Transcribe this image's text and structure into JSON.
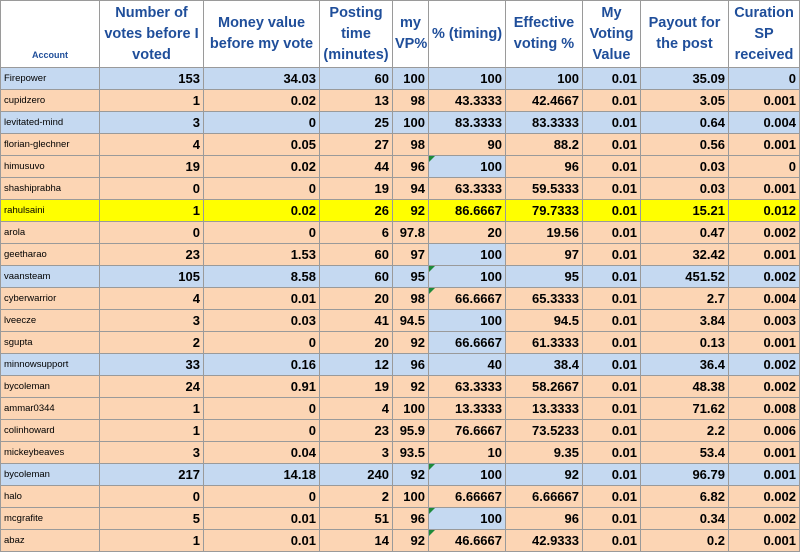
{
  "headers": [
    "Account",
    "Number of votes before I voted",
    "Money value before my vote",
    "Posting time (minutes)",
    "my VP%",
    "% (timing)",
    "Effective voting %",
    "My Voting Value",
    "Payout for the post",
    "Curation SP received"
  ],
  "rows": [
    {
      "account": "Firepower",
      "votes": "153",
      "money": "34.03",
      "time": "60",
      "vp": "100",
      "timing": "100",
      "effective": "100",
      "value": "0.01",
      "payout": "35.09",
      "curation": "0",
      "bg": "blue"
    },
    {
      "account": "cupidzero",
      "votes": "1",
      "money": "0.02",
      "time": "13",
      "vp": "98",
      "timing": "43.3333",
      "effective": "42.4667",
      "value": "0.01",
      "payout": "3.05",
      "curation": "0.001",
      "bg": "peach"
    },
    {
      "account": "levitated-mind",
      "votes": "3",
      "money": "0",
      "time": "25",
      "vp": "100",
      "timing": "83.3333",
      "effective": "83.3333",
      "value": "0.01",
      "payout": "0.64",
      "curation": "0.004",
      "bg": "blue"
    },
    {
      "account": "florian-glechner",
      "votes": "4",
      "money": "0.05",
      "time": "27",
      "vp": "98",
      "timing": "90",
      "effective": "88.2",
      "value": "0.01",
      "payout": "0.56",
      "curation": "0.001",
      "bg": "peach"
    },
    {
      "account": "himusuvo",
      "votes": "19",
      "money": "0.02",
      "time": "44",
      "vp": "96",
      "timing": "100",
      "effective": "96",
      "value": "0.01",
      "payout": "0.03",
      "curation": "0",
      "bg": "peach",
      "timingBg": "blue",
      "timingTri": true
    },
    {
      "account": "shashiprabha",
      "votes": "0",
      "money": "0",
      "time": "19",
      "vp": "94",
      "timing": "63.3333",
      "effective": "59.5333",
      "value": "0.01",
      "payout": "0.03",
      "curation": "0.001",
      "bg": "peach"
    },
    {
      "account": "rahulsaini",
      "votes": "1",
      "money": "0.02",
      "time": "26",
      "vp": "92",
      "timing": "86.6667",
      "effective": "79.7333",
      "value": "0.01",
      "payout": "15.21",
      "curation": "0.012",
      "bg": "yellow"
    },
    {
      "account": "arola",
      "votes": "0",
      "money": "0",
      "time": "6",
      "vp": "97.8",
      "timing": "20",
      "effective": "19.56",
      "value": "0.01",
      "payout": "0.47",
      "curation": "0.002",
      "bg": "peach"
    },
    {
      "account": "geetharao",
      "votes": "23",
      "money": "1.53",
      "time": "60",
      "vp": "97",
      "timing": "100",
      "effective": "97",
      "value": "0.01",
      "payout": "32.42",
      "curation": "0.001",
      "bg": "peach",
      "timingBg": "blue"
    },
    {
      "account": "vaansteam",
      "votes": "105",
      "money": "8.58",
      "time": "60",
      "vp": "95",
      "timing": "100",
      "effective": "95",
      "value": "0.01",
      "payout": "451.52",
      "curation": "0.002",
      "bg": "blue",
      "timingTri": true
    },
    {
      "account": "cyberwarrior",
      "votes": "4",
      "money": "0.01",
      "time": "20",
      "vp": "98",
      "timing": "66.6667",
      "effective": "65.3333",
      "value": "0.01",
      "payout": "2.7",
      "curation": "0.004",
      "bg": "peach",
      "timingTri": true
    },
    {
      "account": "lveecze",
      "votes": "3",
      "money": "0.03",
      "time": "41",
      "vp": "94.5",
      "timing": "100",
      "effective": "94.5",
      "value": "0.01",
      "payout": "3.84",
      "curation": "0.003",
      "bg": "peach",
      "timingBg": "blue"
    },
    {
      "account": "sgupta",
      "votes": "2",
      "money": "0",
      "time": "20",
      "vp": "92",
      "timing": "66.6667",
      "effective": "61.3333",
      "value": "0.01",
      "payout": "0.13",
      "curation": "0.001",
      "bg": "peach",
      "timingBg": "blue"
    },
    {
      "account": "minnowsupport",
      "votes": "33",
      "money": "0.16",
      "time": "12",
      "vp": "96",
      "timing": "40",
      "effective": "38.4",
      "value": "0.01",
      "payout": "36.4",
      "curation": "0.002",
      "bg": "blue"
    },
    {
      "account": "bycoleman",
      "votes": "24",
      "money": "0.91",
      "time": "19",
      "vp": "92",
      "timing": "63.3333",
      "effective": "58.2667",
      "value": "0.01",
      "payout": "48.38",
      "curation": "0.002",
      "bg": "peach"
    },
    {
      "account": "ammar0344",
      "votes": "1",
      "money": "0",
      "time": "4",
      "vp": "100",
      "timing": "13.3333",
      "effective": "13.3333",
      "value": "0.01",
      "payout": "71.62",
      "curation": "0.008",
      "bg": "peach"
    },
    {
      "account": "colinhoward",
      "votes": "1",
      "money": "0",
      "time": "23",
      "vp": "95.9",
      "timing": "76.6667",
      "effective": "73.5233",
      "value": "0.01",
      "payout": "2.2",
      "curation": "0.006",
      "bg": "peach"
    },
    {
      "account": "mickeybeaves",
      "votes": "3",
      "money": "0.04",
      "time": "3",
      "vp": "93.5",
      "timing": "10",
      "effective": "9.35",
      "value": "0.01",
      "payout": "53.4",
      "curation": "0.001",
      "bg": "peach"
    },
    {
      "account": "bycoleman",
      "votes": "217",
      "money": "14.18",
      "time": "240",
      "vp": "92",
      "timing": "100",
      "effective": "92",
      "value": "0.01",
      "payout": "96.79",
      "curation": "0.001",
      "bg": "blue",
      "timingTri": true
    },
    {
      "account": "halo",
      "votes": "0",
      "money": "0",
      "time": "2",
      "vp": "100",
      "timing": "6.66667",
      "effective": "6.66667",
      "value": "0.01",
      "payout": "6.82",
      "curation": "0.002",
      "bg": "peach"
    },
    {
      "account": "mcgrafite",
      "votes": "5",
      "money": "0.01",
      "time": "51",
      "vp": "96",
      "timing": "100",
      "effective": "96",
      "value": "0.01",
      "payout": "0.34",
      "curation": "0.002",
      "bg": "peach",
      "timingBg": "blue",
      "timingTri": true
    },
    {
      "account": "abaz",
      "votes": "1",
      "money": "0.01",
      "time": "14",
      "vp": "92",
      "timing": "46.6667",
      "effective": "42.9333",
      "value": "0.01",
      "payout": "0.2",
      "curation": "0.001",
      "bg": "peach",
      "timingTri": true
    }
  ]
}
